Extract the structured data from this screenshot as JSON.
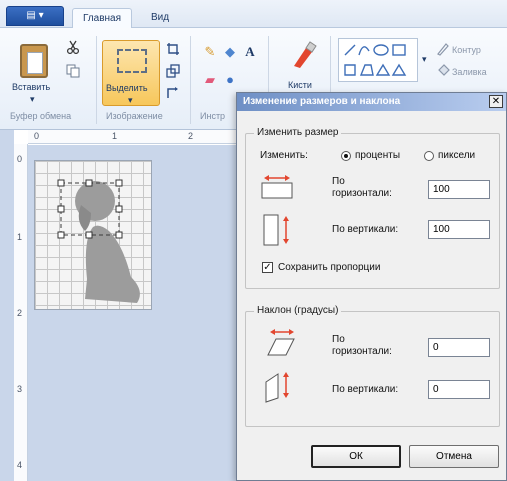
{
  "tabs": {
    "app_menu_icon": "menu-icon",
    "home": "Главная",
    "view": "Вид"
  },
  "ribbon": {
    "paste_label": "Вставить",
    "clipboard_group": "Буфер обмена",
    "select_label": "Выделить",
    "image_group": "Изображение",
    "tools_group_partial": "Инстр",
    "brushes_label": "Кисти",
    "outline_label": "Контур",
    "fill_label": "Заливка"
  },
  "rulers": {
    "top": [
      "0",
      "1",
      "2"
    ],
    "left": [
      "0",
      "1",
      "2",
      "3",
      "4"
    ]
  },
  "dialog": {
    "title": "Изменение размеров и наклона",
    "close_label": "✕",
    "resize": {
      "title": "Изменить размер",
      "by_label": "Изменить:",
      "percent_label": "проценты",
      "pixels_label": "пиксели",
      "selected_mode": "проценты",
      "horizontal_label_1": "По",
      "horizontal_label_2": "горизонтали:",
      "horizontal_value": "100",
      "vertical_label": "По вертикали:",
      "vertical_value": "100",
      "keep_ratio_label": "Сохранить пропорции",
      "keep_ratio_checked": true
    },
    "skew": {
      "title": "Наклон (градусы)",
      "horizontal_label_1": "По",
      "horizontal_label_2": "горизонтали:",
      "horizontal_value": "0",
      "vertical_label": "По вертикали:",
      "vertical_value": "0"
    },
    "ok_label": "ОК",
    "cancel_label": "Отмена"
  },
  "colors": {
    "accent_select": "#f7c75b",
    "arrow_red": "#e2462f",
    "workspace": "#c9d6ea"
  }
}
